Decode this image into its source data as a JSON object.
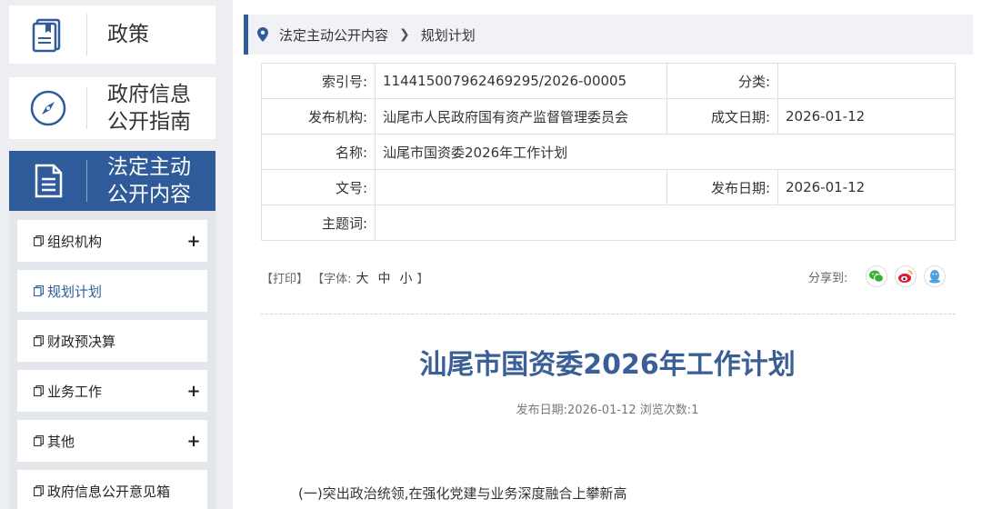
{
  "sidebar": {
    "big_nav": [
      {
        "label": "政策",
        "icon": "document-book-icon"
      },
      {
        "label": "政府信息\n公开指南",
        "icon": "compass-icon"
      },
      {
        "label": "法定主动\n公开内容",
        "icon": "document-list-icon"
      }
    ],
    "sub_items": [
      {
        "label": "组织机构",
        "expand": "+"
      },
      {
        "label": "规划计划"
      },
      {
        "label": "财政预决算"
      },
      {
        "label": "业务工作",
        "expand": "+"
      },
      {
        "label": "其他",
        "expand": "+"
      },
      {
        "label": "政府信息公开意见箱"
      }
    ]
  },
  "breadcrumb": {
    "section": "法定主动公开内容",
    "current": "规划计划"
  },
  "meta": {
    "index_label": "索引号:",
    "index_value": "114415007962469295/2026-00005",
    "category_label": "分类:",
    "category_value": "",
    "publisher_label": "发布机构:",
    "publisher_value": "汕尾市人民政府国有资产监督管理委员会",
    "created_label": "成文日期:",
    "created_value": "2026-01-12",
    "name_label": "名称:",
    "name_value": "汕尾市国资委2026年工作计划",
    "docno_label": "文号:",
    "docno_value": "",
    "pubdate_label": "发布日期:",
    "pubdate_value": "2026-01-12",
    "subject_label": "主题词:",
    "subject_value": ""
  },
  "tools": {
    "print": "【打印】",
    "font_prefix": "【字体:",
    "large": "大",
    "medium": "中",
    "small": "小",
    "font_suffix": "】"
  },
  "share": {
    "label": "分享到:",
    "targets": [
      "wechat-icon",
      "weibo-icon",
      "qq-icon"
    ],
    "colors": {
      "wechat": "#3cb034",
      "weibo": "#e6162d",
      "qq": "#4aa3df"
    }
  },
  "article": {
    "title": "汕尾市国资委2026年工作计划",
    "pub_info": "发布日期:2026-01-12  浏览次数:1",
    "first_line": "(一)突出政治统领,在强化党建与业务深度融合上攀新高"
  },
  "colors": {
    "brand": "#2f5b9a",
    "title": "#3a5f97"
  }
}
